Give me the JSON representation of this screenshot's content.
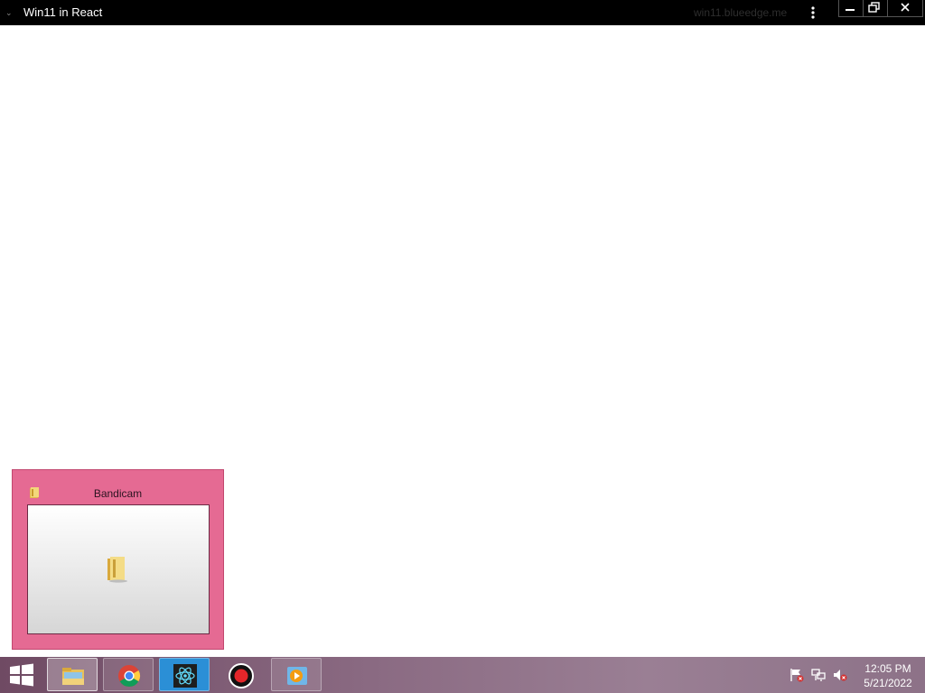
{
  "window": {
    "title": "Win11 in React",
    "url": "win11.blueedge.me",
    "collapse_glyph": "⌄",
    "controls": [
      "minimize-icon",
      "restore-icon",
      "close-icon"
    ]
  },
  "preview": {
    "title": "Bandicam",
    "icon": "folder-icon"
  },
  "taskbar": {
    "start_icon": "windows-logo-icon",
    "apps": [
      {
        "name": "file-explorer",
        "icon": "folder-icon",
        "state": "active"
      },
      {
        "name": "chrome",
        "icon": "chrome-icon",
        "state": "open"
      },
      {
        "name": "react-app",
        "icon": "react-icon",
        "state": "open"
      },
      {
        "name": "bandicam",
        "icon": "record-icon",
        "state": "open"
      },
      {
        "name": "media-player",
        "icon": "media-player-icon",
        "state": "open"
      }
    ],
    "tray": [
      "action-center-flag-icon",
      "network-icon",
      "volume-muted-icon"
    ],
    "clock": {
      "time": "12:05 PM",
      "date": "5/21/2022"
    }
  },
  "colors": {
    "titlebar_bg": "#000000",
    "preview_bg": "#e56a93",
    "taskbar_bg": "#8a6a82",
    "desktop_bg": "#ffffff"
  }
}
